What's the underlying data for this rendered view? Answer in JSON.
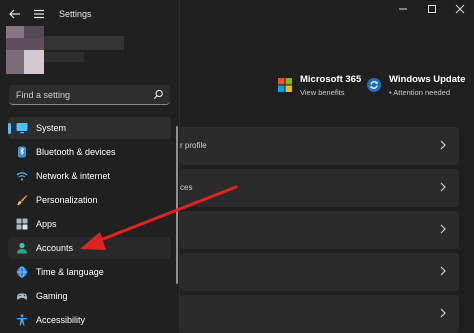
{
  "app": {
    "title": "Settings"
  },
  "search": {
    "placeholder": "Find a setting"
  },
  "nav": {
    "items": [
      {
        "label": "System",
        "icon": "monitor-icon",
        "selected": true
      },
      {
        "label": "Bluetooth & devices",
        "icon": "bluetooth-icon"
      },
      {
        "label": "Network & internet",
        "icon": "wifi-icon"
      },
      {
        "label": "Personalization",
        "icon": "brush-icon"
      },
      {
        "label": "Apps",
        "icon": "apps-grid-icon"
      },
      {
        "label": "Accounts",
        "icon": "person-icon"
      },
      {
        "label": "Time & language",
        "icon": "globe-clock-icon"
      },
      {
        "label": "Gaming",
        "icon": "gamepad-icon"
      },
      {
        "label": "Accessibility",
        "icon": "accessibility-icon"
      }
    ]
  },
  "header": {
    "microsoft365": {
      "title": "Microsoft 365",
      "subtitle": "View benefits"
    },
    "windows_update": {
      "title": "Windows Update",
      "subtitle": "• Attention needed"
    }
  },
  "content": {
    "rows": [
      {
        "text": "r profile"
      },
      {
        "text": "ces"
      },
      {
        "text": ""
      },
      {
        "text": ""
      },
      {
        "text": ""
      }
    ]
  },
  "colors": {
    "accent": "#4cc2ff",
    "annotation_arrow": "#e0231f",
    "background": "#1f1f1f"
  }
}
